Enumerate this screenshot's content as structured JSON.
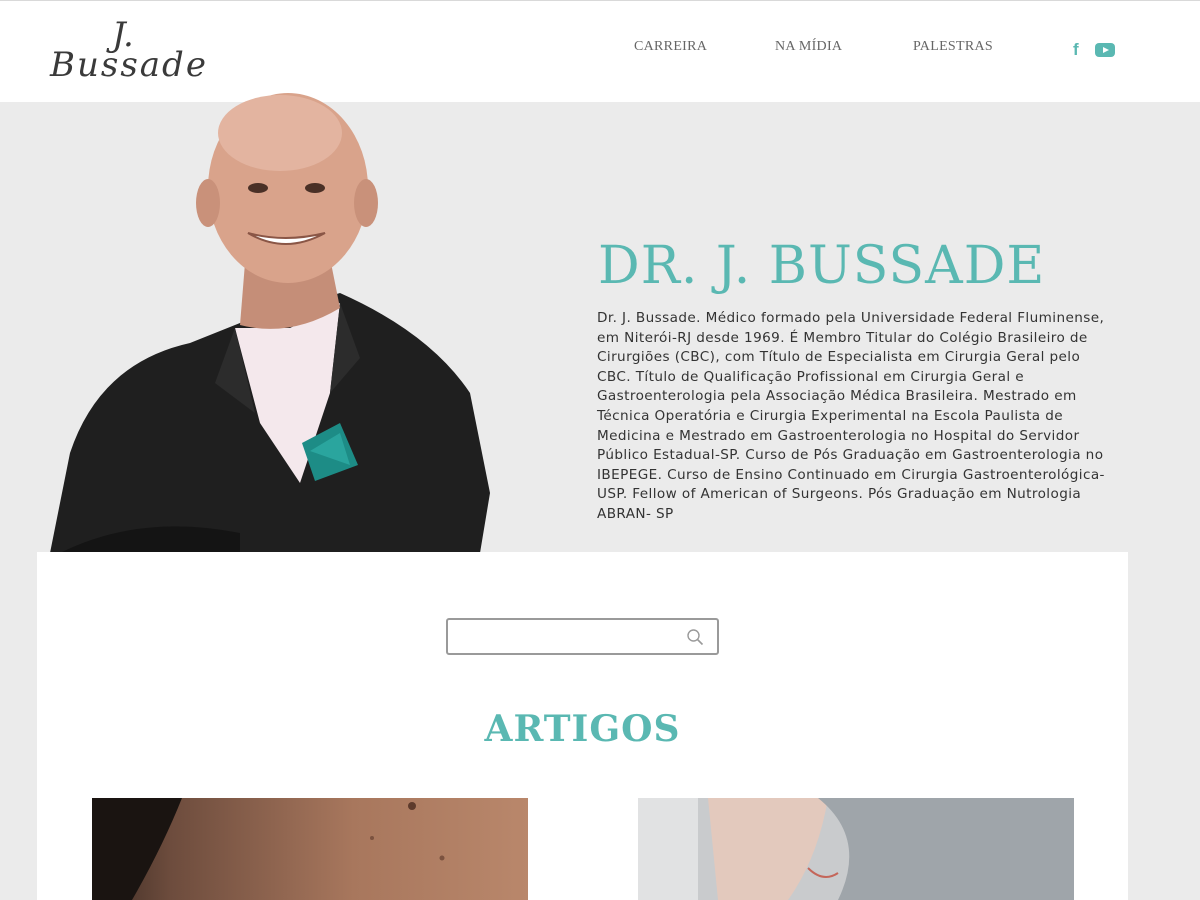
{
  "logo": {
    "initial": "J.",
    "name": "Bussade"
  },
  "nav": {
    "items": [
      {
        "label": "CARREIRA"
      },
      {
        "label": "NA MÍDIA"
      },
      {
        "label": "PALESTRAS"
      }
    ]
  },
  "social": {
    "facebook_icon": "facebook-icon",
    "youtube_icon": "youtube-icon",
    "accent": "#5ab8b2"
  },
  "hero": {
    "title": "DR. J. BUSSADE",
    "bio": "Dr. J. Bussade. Médico formado pela Universidade Federal Fluminense, em Niterói-RJ desde 1969. É Membro Titular do Colégio Brasileiro de Cirurgiões (CBC), com Título de Especialista em Cirurgia Geral pelo CBC. Título de Qualificação Profissional em Cirurgia Geral e Gastroenterologia pela Associação Médica Brasileira. Mestrado em Técnica Operatória e Cirurgia Experimental na Escola Paulista de Medicina e Mestrado em Gastroenterologia no Hospital do Servidor Público Estadual-SP. Curso de Pós Graduação em Gastroenterologia no IBEPEGE. Curso de Ensino Continuado em Cirurgia Gastroenterológica-USP. Fellow of American of Surgeons. Pós Graduação em Nutrologia ABRAN- SP"
  },
  "search": {
    "value": "",
    "placeholder": ""
  },
  "articles": {
    "title": "ARTIGOS"
  },
  "colors": {
    "accent": "#5ab8b2",
    "hero_bg": "#ebebeb",
    "text": "#333333"
  }
}
